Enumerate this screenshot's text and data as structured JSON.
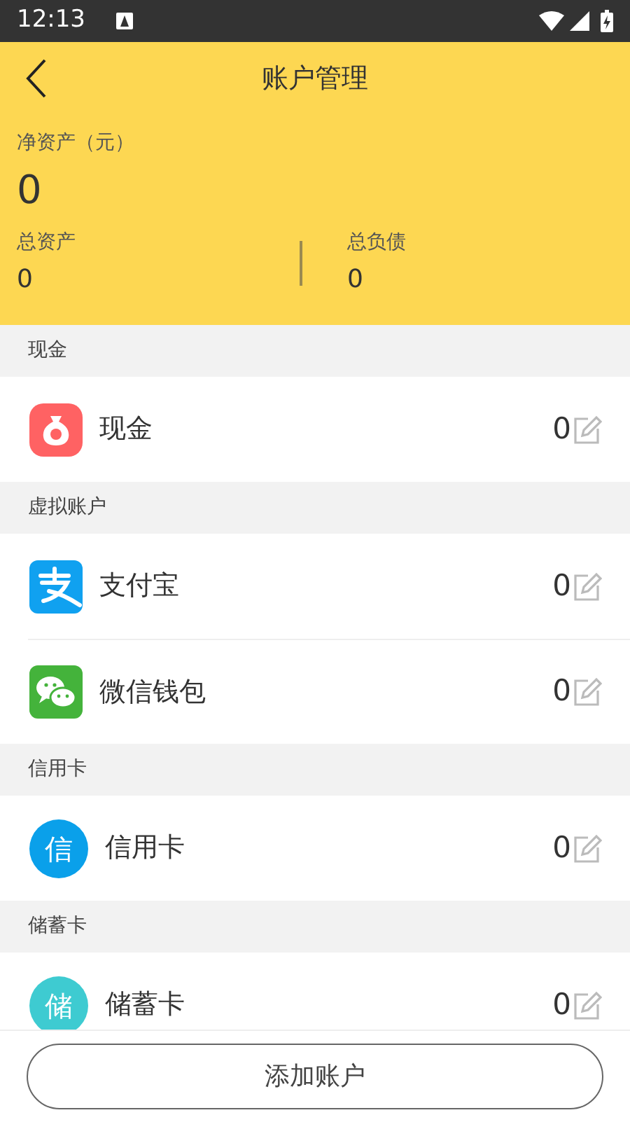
{
  "status_bar": {
    "time": "12:13"
  },
  "header": {
    "title": "账户管理",
    "net_label": "净资产（元）",
    "net_value": "0",
    "total_assets_label": "总资产",
    "total_assets_value": "0",
    "total_debt_label": "总负债",
    "total_debt_value": "0"
  },
  "sections": [
    {
      "title": "现金",
      "accounts": [
        {
          "name": "现金",
          "balance": "0",
          "kind": "moneybag",
          "color": "#ff6263"
        }
      ]
    },
    {
      "title": "虚拟账户",
      "accounts": [
        {
          "name": "支付宝",
          "balance": "0",
          "kind": "alipay",
          "color": "#10a1f0"
        },
        {
          "name": "微信钱包",
          "balance": "0",
          "kind": "wechat",
          "color": "#44b33b"
        }
      ]
    },
    {
      "title": "信用卡",
      "accounts": [
        {
          "name": "信用卡",
          "balance": "0",
          "kind": "letter",
          "badge": "信",
          "color": "#0aa0ea"
        }
      ]
    },
    {
      "title": "储蓄卡",
      "accounts": [
        {
          "name": "储蓄卡",
          "balance": "0",
          "kind": "letter",
          "badge": "储",
          "color": "#3ecbd1"
        }
      ]
    }
  ],
  "add_button": "添加账户"
}
